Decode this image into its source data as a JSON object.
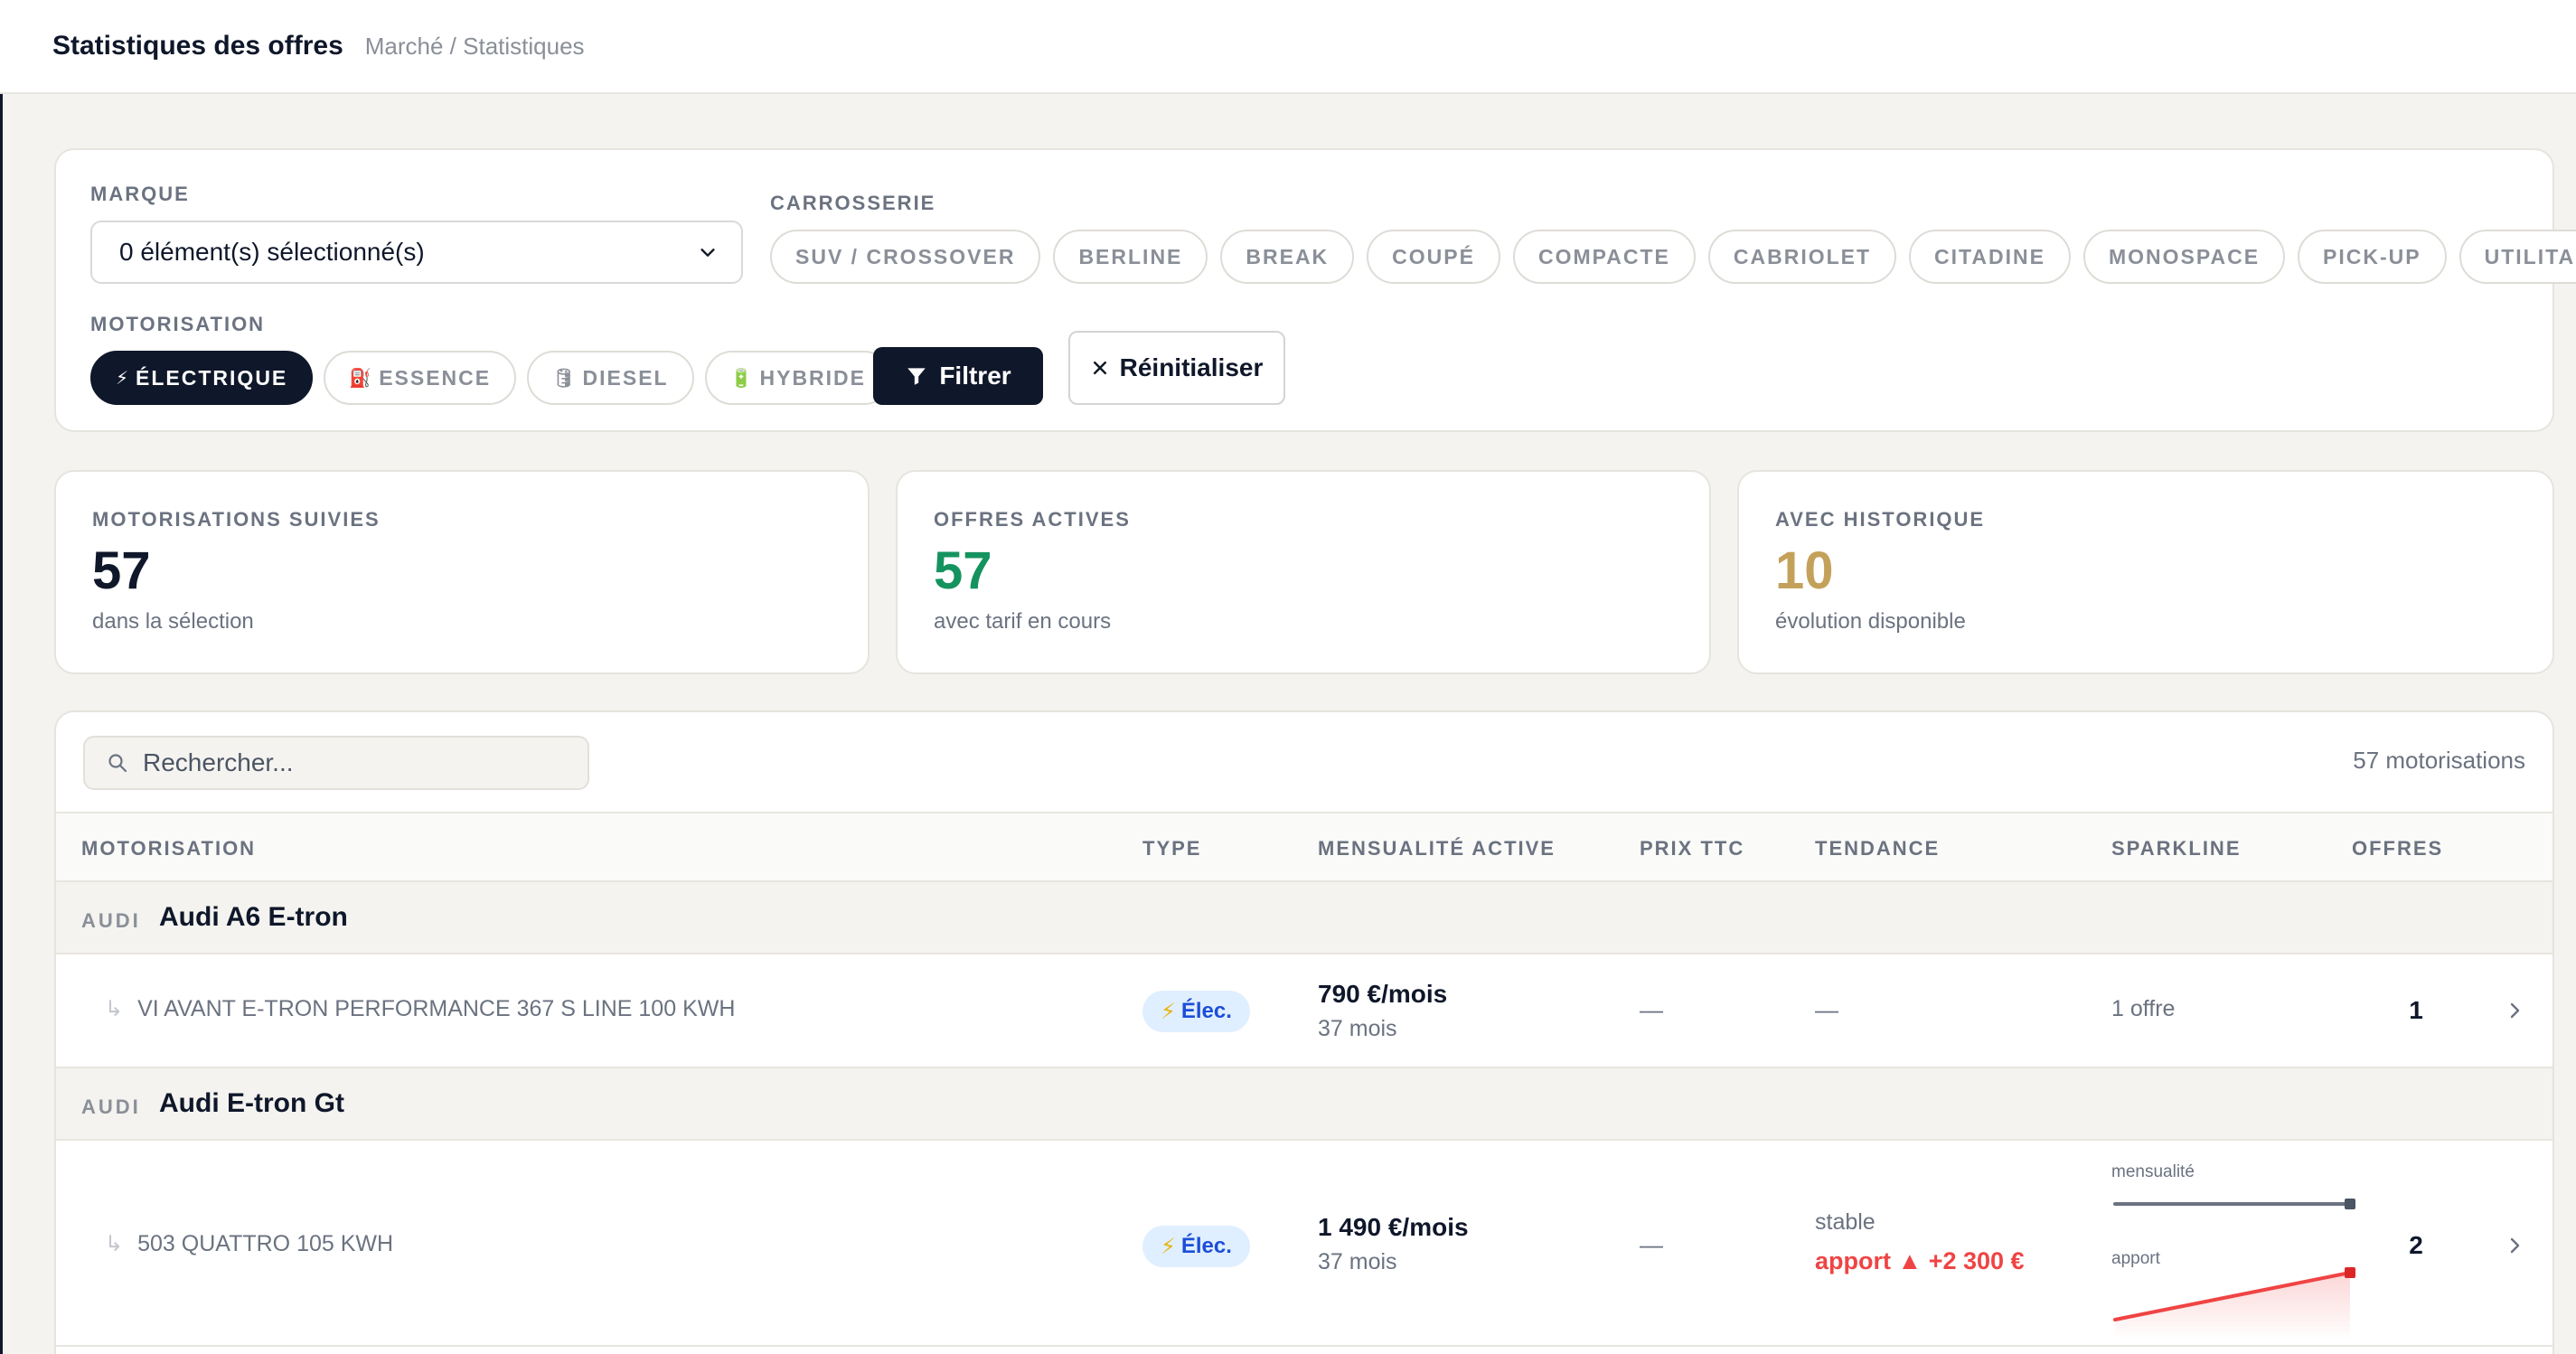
{
  "header": {
    "title": "Statistiques des offres",
    "breadcrumb": "Marché / Statistiques"
  },
  "filters": {
    "marque_label": "MARQUE",
    "marque_value": "0 élément(s) sélectionné(s)",
    "carrosserie_label": "CARROSSERIE",
    "carrosserie": [
      "SUV / CROSSOVER",
      "BERLINE",
      "BREAK",
      "COUPÉ",
      "COMPACTE",
      "CABRIOLET",
      "CITADINE",
      "MONOSPACE",
      "PICK-UP",
      "UTILITAIRE"
    ],
    "motorisation_label": "MOTORISATION",
    "motorisation": [
      {
        "label": "ÉLECTRIQUE",
        "icon": "⚡",
        "active": true
      },
      {
        "label": "ESSENCE",
        "icon": "⛽",
        "active": false
      },
      {
        "label": "DIESEL",
        "icon": "🛢",
        "active": false
      },
      {
        "label": "HYBRIDE",
        "icon": "🔋",
        "active": false
      }
    ],
    "filter_button": "Filtrer",
    "reset_button": "Réinitialiser"
  },
  "stats": [
    {
      "label": "MOTORISATIONS SUIVIES",
      "value": "57",
      "sub": "dans la sélection",
      "color": "#0f172a"
    },
    {
      "label": "OFFRES ACTIVES",
      "value": "57",
      "sub": "avec tarif en cours",
      "color": "#15935f"
    },
    {
      "label": "AVEC HISTORIQUE",
      "value": "10",
      "sub": "évolution disponible",
      "color": "#c4a15a"
    }
  ],
  "table": {
    "search_placeholder": "Rechercher...",
    "count": "57 motorisations",
    "columns": [
      "MOTORISATION",
      "TYPE",
      "MENSUALITÉ ACTIVE",
      "PRIX TTC",
      "TENDANCE",
      "SPARKLINE",
      "OFFRES"
    ],
    "groups": [
      {
        "brand": "AUDI",
        "model": "Audi A6 E-tron",
        "rows": [
          {
            "variant": "VI AVANT E-TRON PERFORMANCE 367 S LINE 100 KWH",
            "type": "Élec.",
            "price": "790 €/mois",
            "duration": "37 mois",
            "prix_ttc": "—",
            "tendance": "—",
            "sparkline": "1 offre",
            "offers": "1"
          }
        ]
      },
      {
        "brand": "AUDI",
        "model": "Audi E-tron Gt",
        "rows": [
          {
            "variant": "503 QUATTRO 105 KWH",
            "type": "Élec.",
            "price": "1 490 €/mois",
            "duration": "37 mois",
            "prix_ttc": "—",
            "tendance_status": "stable",
            "tendance_apport": "apport ▲ +2 300 €",
            "spark_label_1": "mensualité",
            "spark_label_2": "apport",
            "offers": "2"
          }
        ]
      }
    ]
  },
  "colors": {
    "navy": "#0f172a",
    "green": "#15935f",
    "gold": "#c4a15a",
    "red": "#ef4444",
    "badge_bg": "#e0efff"
  }
}
